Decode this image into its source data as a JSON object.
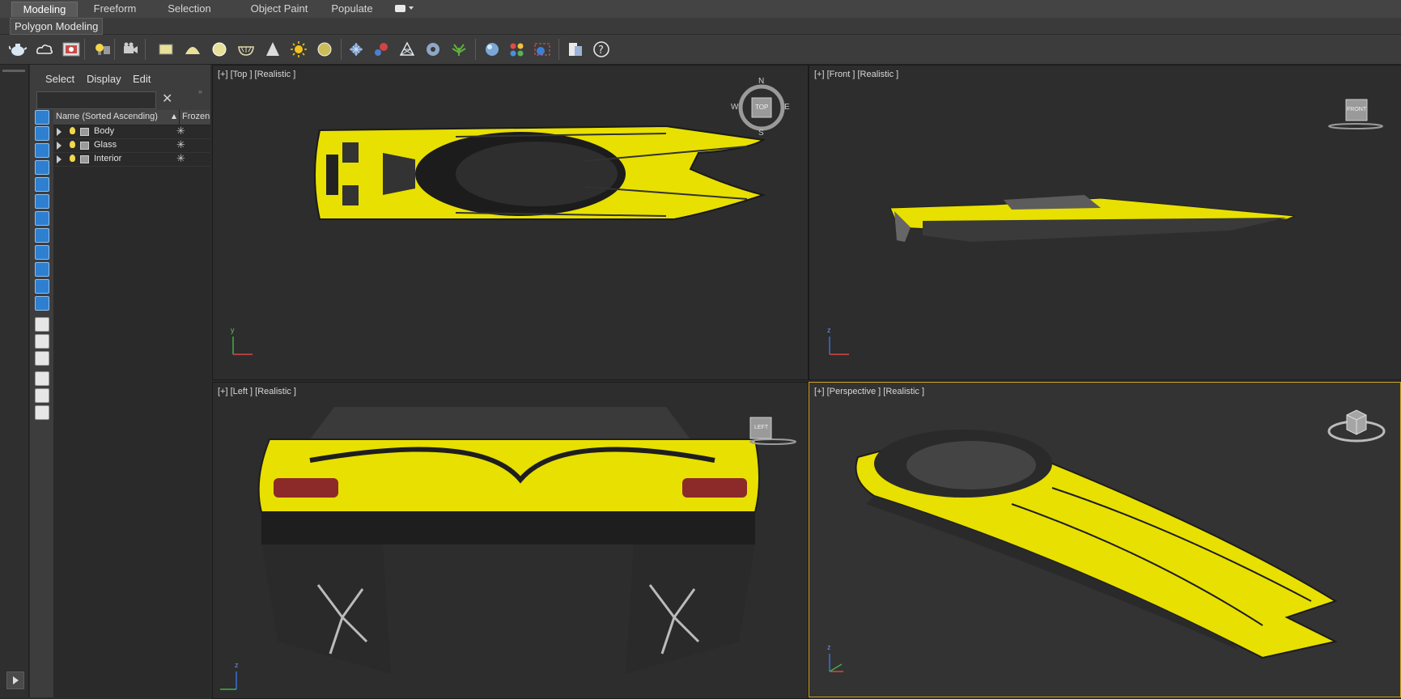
{
  "ribbon": {
    "tabs": [
      "Modeling",
      "Freeform",
      "Selection",
      "Object Paint",
      "Populate"
    ],
    "sub_button": "Polygon Modeling"
  },
  "toolbar": {
    "icons": [
      "teapot-icon",
      "cloud-icon",
      "render-frame-icon",
      "light-list-icon",
      "camera-icon",
      "plane-icon",
      "dome-icon",
      "sphere-icon",
      "bowl-icon",
      "cone-light-icon",
      "sun-icon",
      "disc-icon",
      "grid-icon",
      "particles-icon",
      "mesh-icon",
      "gear-icon",
      "plant-icon",
      "material-sphere-icon",
      "palette-icon",
      "render-icon",
      "layer-icon",
      "help-icon"
    ]
  },
  "explorer": {
    "menu": [
      "Select",
      "Display",
      "Edit"
    ],
    "column_name": "Name (Sorted Ascending)",
    "column_frozen": "Frozen",
    "rows": [
      {
        "name": "Body"
      },
      {
        "name": "Glass"
      },
      {
        "name": "Interior"
      }
    ]
  },
  "viewports": {
    "top": {
      "label": "[+] [Top ] [Realistic ]",
      "cube": "TOP",
      "compass": [
        "N",
        "E",
        "S",
        "W"
      ]
    },
    "front": {
      "label": "[+] [Front ] [Realistic ]",
      "cube": "FRONT"
    },
    "left": {
      "label": "[+] [Left ] [Realistic ]",
      "cube": "LEFT"
    },
    "perspective": {
      "label": "[+] [Perspective ] [Realistic ]"
    }
  },
  "axes": {
    "x": "x",
    "y": "y",
    "z": "z"
  },
  "colors": {
    "accent": "#c9a227",
    "hull": "#e8e000",
    "selected_icon": "#2f7fd0"
  }
}
